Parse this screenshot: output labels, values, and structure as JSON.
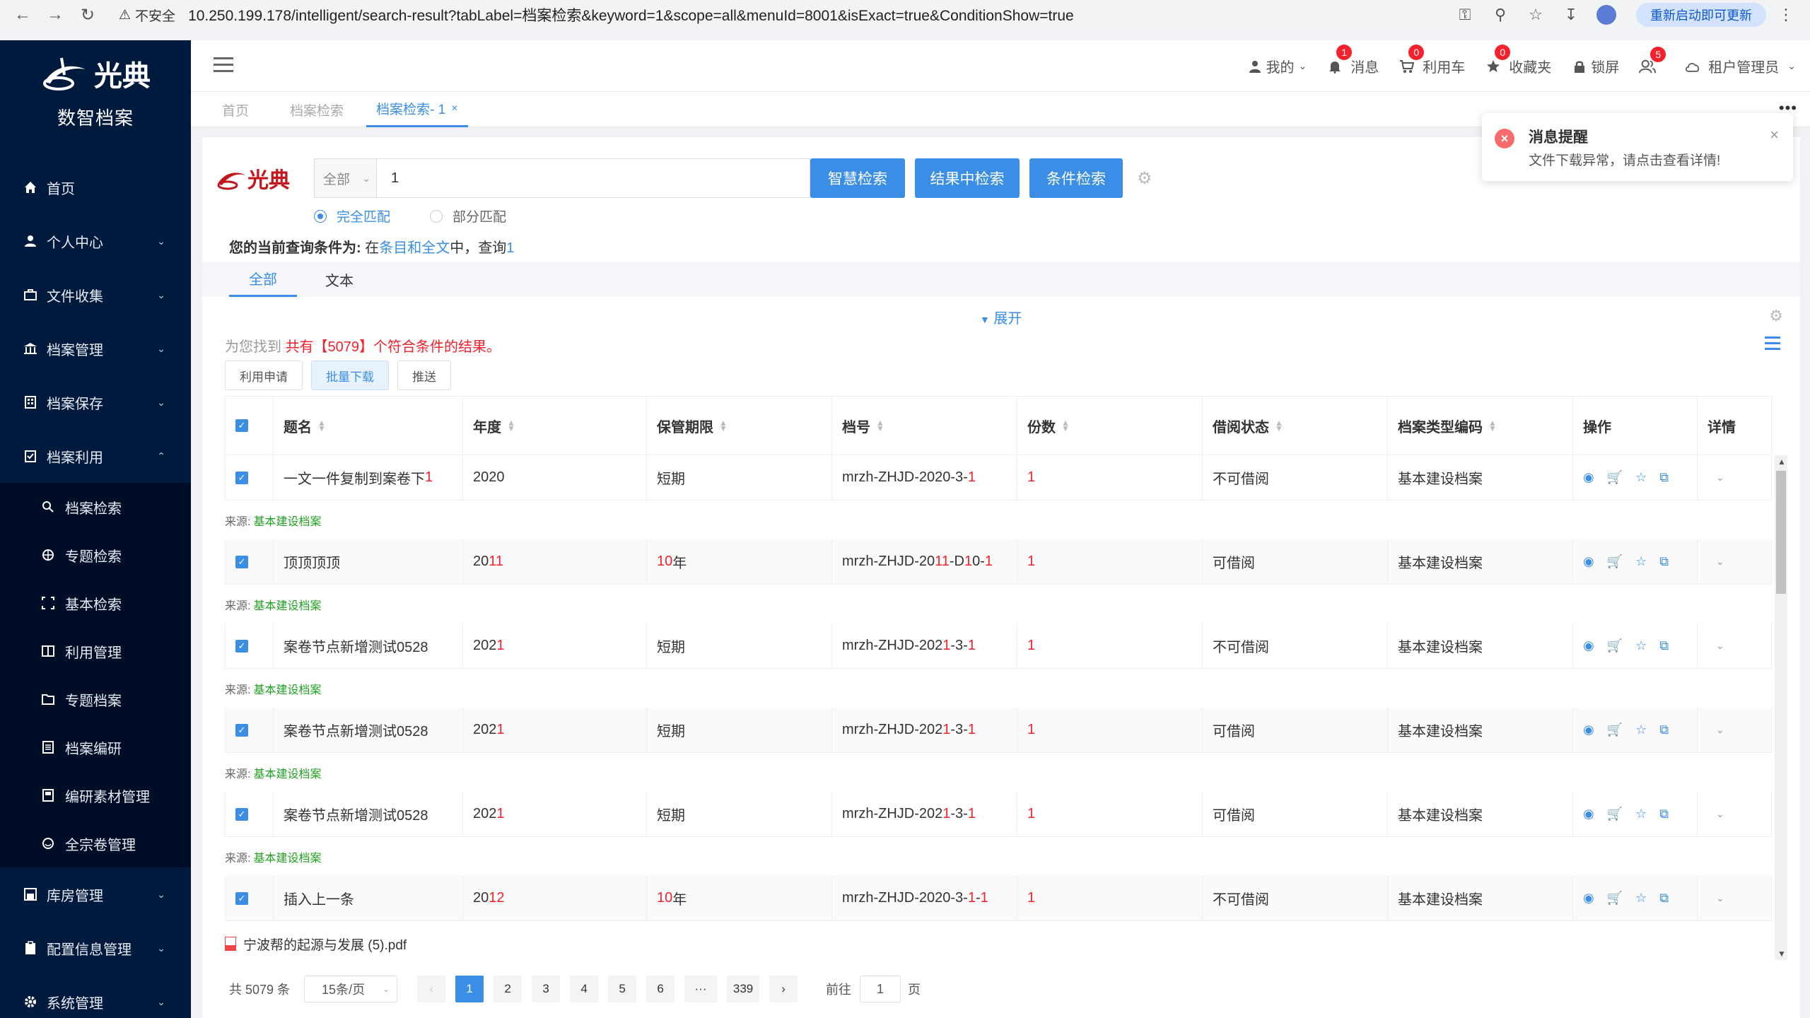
{
  "browser": {
    "insecure_label": "不安全",
    "url": "10.250.199.178/intelligent/search-result?tabLabel=档案检索&keyword=1&scope=all&menuId=8001&isExact=true&ConditionShow=true",
    "restart_label": "重新启动即可更新"
  },
  "sidebar": {
    "logo_text": "光典",
    "logo_sub": "数智档案",
    "items": [
      {
        "label": "首页"
      },
      {
        "label": "个人中心"
      },
      {
        "label": "文件收集"
      },
      {
        "label": "档案管理"
      },
      {
        "label": "档案保存"
      },
      {
        "label": "档案利用"
      }
    ],
    "sub_items": [
      {
        "label": "档案检索"
      },
      {
        "label": "专题检索"
      },
      {
        "label": "基本检索"
      },
      {
        "label": "利用管理"
      },
      {
        "label": "专题档案"
      },
      {
        "label": "档案编研"
      },
      {
        "label": "编研素材管理"
      },
      {
        "label": "全宗卷管理"
      }
    ],
    "bottom_items": [
      {
        "label": "库房管理"
      },
      {
        "label": "配置信息管理"
      },
      {
        "label": "系统管理"
      }
    ]
  },
  "header": {
    "mine": "我的",
    "messages": "消息",
    "messages_badge": "1",
    "cart": "利用车",
    "cart_badge": "0",
    "favorites": "收藏夹",
    "favorites_badge": "0",
    "lock": "锁屏",
    "users_badge": "5",
    "tenant": "租户管理员"
  },
  "tabs": {
    "home": "首页",
    "archive_search": "档案检索",
    "active": "档案检索- 1"
  },
  "search": {
    "brand": "光典",
    "scope": "全部",
    "keyword": "1",
    "btn_smart": "智慧检索",
    "btn_in_result": "结果中检索",
    "btn_condition": "条件检索",
    "radio_exact": "完全匹配",
    "radio_partial": "部分匹配",
    "cond_prefix": "您的当前查询条件为:",
    "cond_in": " 在",
    "cond_scope": "条目和全文",
    "cond_mid": "中，查询",
    "cond_kw": "1"
  },
  "result_tabs": {
    "all": "全部",
    "text": "文本"
  },
  "results": {
    "expand": "展开",
    "found_prefix": "为您找到 ",
    "found_count": "共有【5079】个符合条件的结果。",
    "btn_apply": "利用申请",
    "btn_download": "批量下载",
    "btn_push": "推送"
  },
  "table": {
    "headers": {
      "title": "题名",
      "year": "年度",
      "retention": "保管期限",
      "archive_no": "档号",
      "copies": "份数",
      "borrow": "借阅状态",
      "type_code": "档案类型编码",
      "ops": "操作",
      "detail": "详情"
    },
    "source_label": "来源:",
    "source_value": "基本建设档案",
    "rows": [
      {
        "title": "一文一件复制到案卷下",
        "title_hl": "1",
        "year": "2020",
        "year_hl": "",
        "retention": "短期",
        "ret_hl": "",
        "no": "mrzh-ZHJD-2020-3-",
        "no_hl": "1",
        "copies": "1",
        "borrow": "不可借阅",
        "type": "基本建设档案"
      },
      {
        "title": "顶顶顶顶",
        "title_hl": "",
        "year": "20",
        "year_hl": "11",
        "retention": "年",
        "ret_hl": "10",
        "no": "mrzh-ZHJD-20",
        "no_hl": "11",
        "no_tail": "-D",
        "no_hl2": "1",
        "no_tail2": "0-",
        "no_hl3": "1",
        "copies": "1",
        "borrow": "可借阅",
        "type": "基本建设档案"
      },
      {
        "title": "案卷节点新增测试0528",
        "title_hl": "",
        "year": "202",
        "year_hl": "1",
        "retention": "短期",
        "ret_hl": "",
        "no": "mrzh-ZHJD-202",
        "no_hl": "1",
        "no_tail": "-3-",
        "no_hl2": "1",
        "copies": "1",
        "borrow": "不可借阅",
        "type": "基本建设档案"
      },
      {
        "title": "案卷节点新增测试0528",
        "title_hl": "",
        "year": "202",
        "year_hl": "1",
        "retention": "短期",
        "ret_hl": "",
        "no": "mrzh-ZHJD-202",
        "no_hl": "1",
        "no_tail": "-3-",
        "no_hl2": "1",
        "copies": "1",
        "borrow": "可借阅",
        "type": "基本建设档案"
      },
      {
        "title": "案卷节点新增测试0528",
        "title_hl": "",
        "year": "202",
        "year_hl": "1",
        "retention": "短期",
        "ret_hl": "",
        "no": "mrzh-ZHJD-202",
        "no_hl": "1",
        "no_tail": "-3-",
        "no_hl2": "1",
        "copies": "1",
        "borrow": "可借阅",
        "type": "基本建设档案"
      },
      {
        "title": "插入上一条",
        "title_hl": "",
        "year": "20",
        "year_hl": "12",
        "retention": "年",
        "ret_hl": "10",
        "no": "mrzh-ZHJD-2020-3-",
        "no_hl": "1",
        "no_tail": "-",
        "no_hl2": "1",
        "copies": "1",
        "borrow": "不可借阅",
        "type": "基本建设档案"
      }
    ],
    "pdf_name": "宁波帮的起源与发展 (5).pdf"
  },
  "pager": {
    "total": "共 5079 条",
    "page_size": "15条/页",
    "pages": [
      "1",
      "2",
      "3",
      "4",
      "5",
      "6",
      "···",
      "339"
    ],
    "goto_label": "前往",
    "goto_value": "1",
    "goto_suffix": "页"
  },
  "toast": {
    "title": "消息提醒",
    "message": "文件下载异常，请点击查看详情!"
  },
  "colors": {
    "accent": "#3a8ee6",
    "sidebar_bg": "#001a3d",
    "highlight": "#f5222d",
    "source_green": "#21a121"
  }
}
